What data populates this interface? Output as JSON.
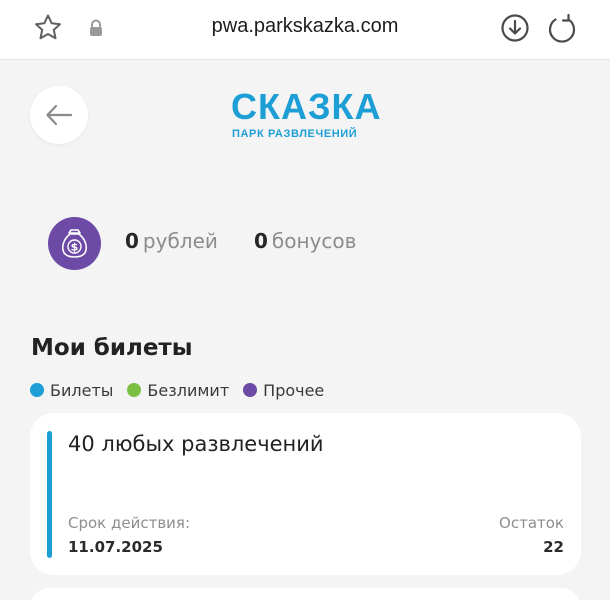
{
  "browser": {
    "url": "pwa.parkskazka.com"
  },
  "header": {
    "logo_main": "СКАЗКА",
    "logo_sub": "ПАРК РАЗВЛЕЧЕНИЙ",
    "brand_color": "#1d9fd6"
  },
  "balance": {
    "rubles_value": "0",
    "rubles_label": "рублей",
    "bonus_value": "0",
    "bonus_label": "бонусов",
    "icon": "money-bag-icon",
    "icon_color": "#6c4aa6"
  },
  "tickets": {
    "title": "Мои билеты",
    "legend": [
      {
        "label": "Билеты",
        "color": "#1d9fd6"
      },
      {
        "label": "Безлимит",
        "color": "#7bc043"
      },
      {
        "label": "Прочее",
        "color": "#6c4aa6"
      }
    ],
    "items": [
      {
        "title": "40 любых развлечений",
        "validity_label": "Срок действия:",
        "validity_value": "11.07.2025",
        "remaining_label": "Остаток",
        "remaining_value": "22"
      }
    ]
  }
}
